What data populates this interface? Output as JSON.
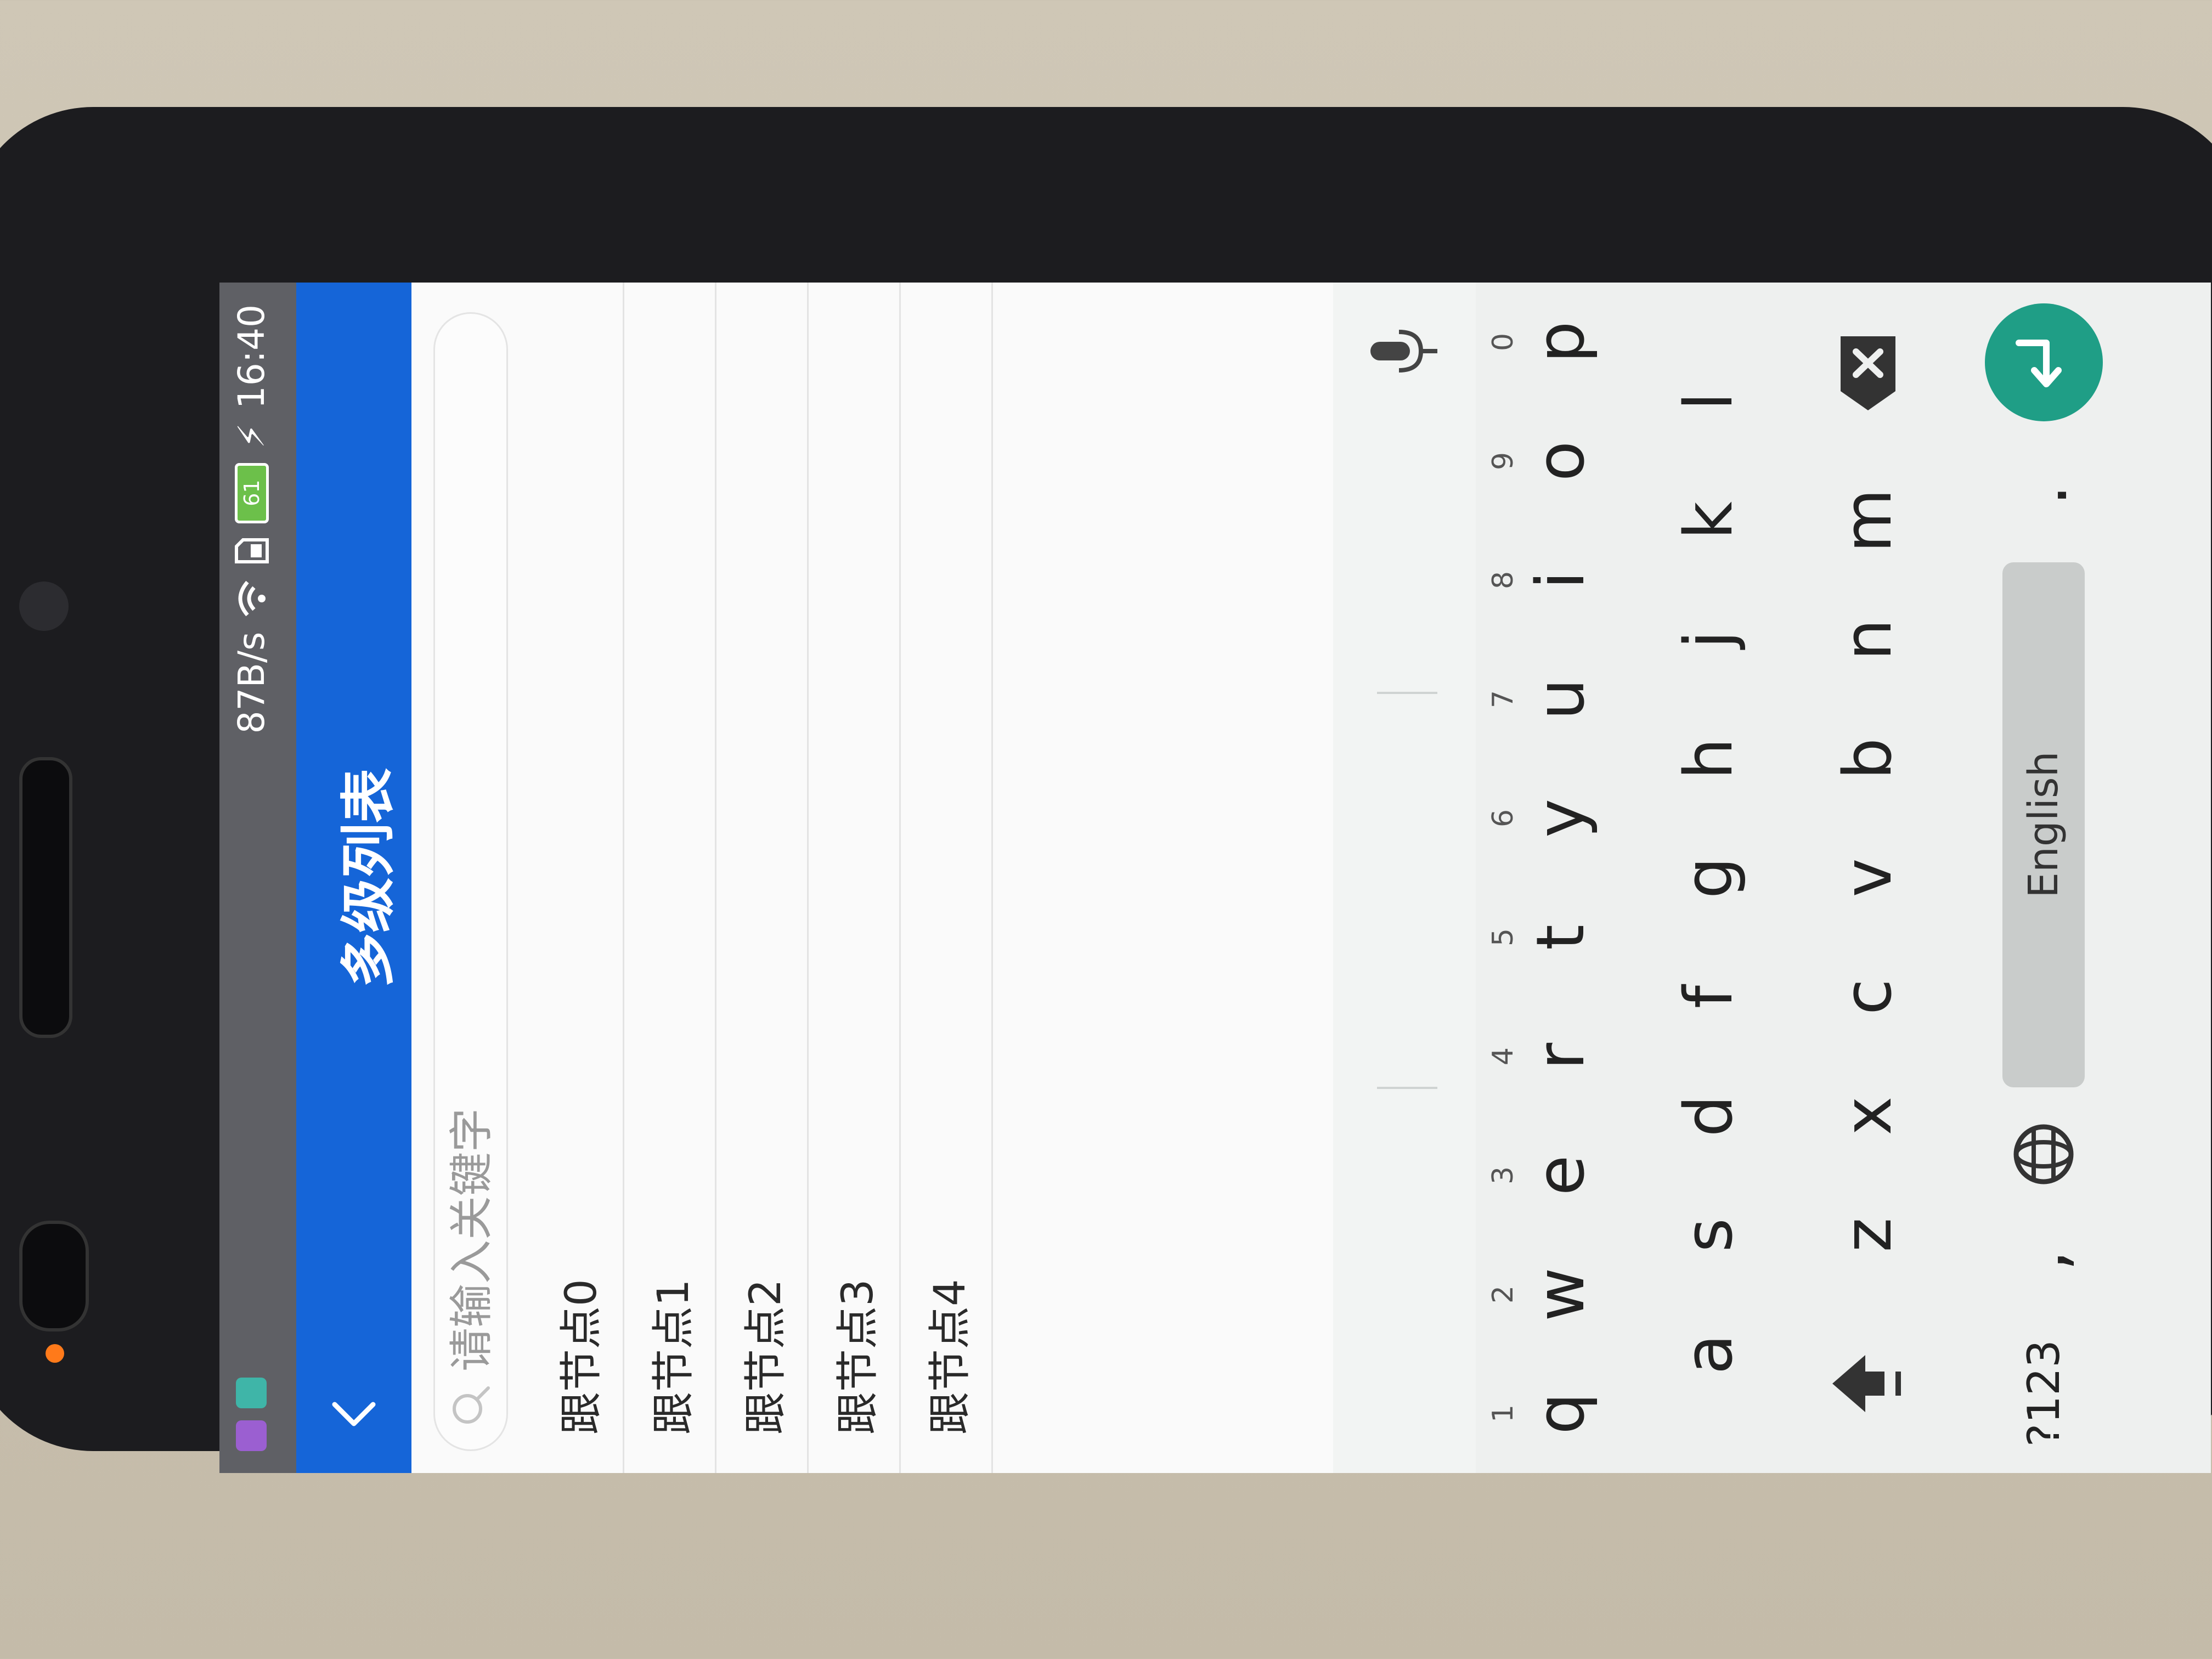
{
  "status_bar": {
    "network_speed": "87B/s",
    "battery_level": "61",
    "time": "16:40"
  },
  "app_bar": {
    "title": "多级列表",
    "back_icon": "chevron-left-icon"
  },
  "search": {
    "placeholder": "请输入关键字",
    "value": ""
  },
  "list": {
    "items": [
      {
        "label": "跟节点0"
      },
      {
        "label": "跟节点1"
      },
      {
        "label": "跟节点2"
      },
      {
        "label": "跟节点3"
      },
      {
        "label": "跟节点4"
      }
    ]
  },
  "keyboard": {
    "row1": [
      {
        "key": "q",
        "hint": "1"
      },
      {
        "key": "w",
        "hint": "2"
      },
      {
        "key": "e",
        "hint": "3"
      },
      {
        "key": "r",
        "hint": "4"
      },
      {
        "key": "t",
        "hint": "5"
      },
      {
        "key": "y",
        "hint": "6"
      },
      {
        "key": "u",
        "hint": "7"
      },
      {
        "key": "i",
        "hint": "8"
      },
      {
        "key": "o",
        "hint": "9"
      },
      {
        "key": "p",
        "hint": "0"
      }
    ],
    "row2": [
      "a",
      "s",
      "d",
      "f",
      "g",
      "h",
      "j",
      "k",
      "l"
    ],
    "row3": [
      "z",
      "x",
      "c",
      "v",
      "b",
      "n",
      "m"
    ],
    "symbols_label": "?123",
    "comma": ",",
    "space_label": "English",
    "period": ".",
    "accent_color": "#1f9e86",
    "app_bar_color": "#1565d8"
  }
}
